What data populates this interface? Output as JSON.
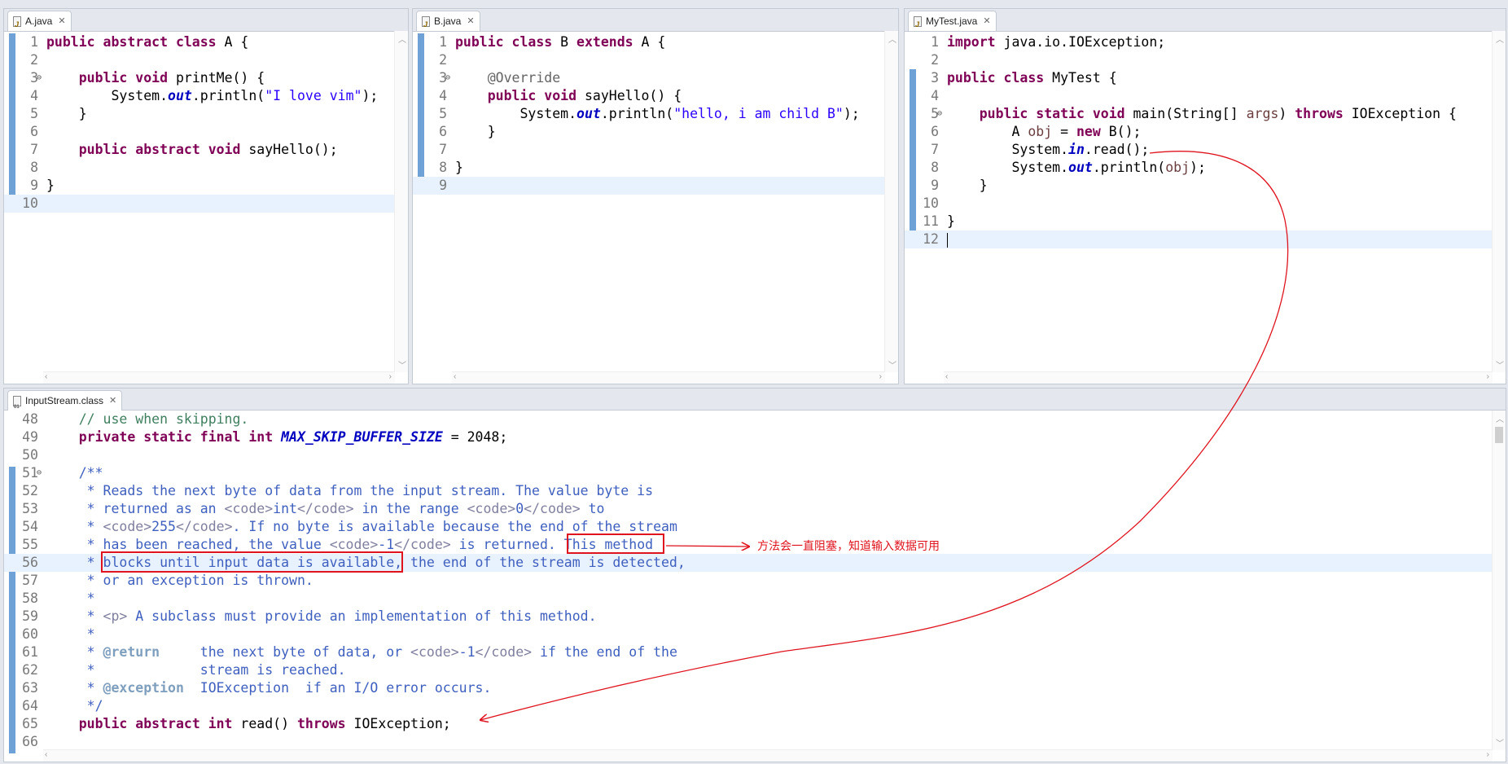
{
  "editors": {
    "a": {
      "tab_label": "A.java",
      "lines": [
        {
          "n": "1",
          "segs": [
            [
              "kw",
              "public abstract class"
            ],
            [
              "",
              " A {"
            ]
          ]
        },
        {
          "n": "2",
          "segs": [
            [
              "",
              ""
            ]
          ]
        },
        {
          "n": "3",
          "mark": "⊖",
          "segs": [
            [
              "",
              "    "
            ],
            [
              "kw",
              "public void"
            ],
            [
              "",
              " printMe() {"
            ]
          ]
        },
        {
          "n": "4",
          "segs": [
            [
              "",
              "        System."
            ],
            [
              "fld",
              "out"
            ],
            [
              "",
              ".println("
            ],
            [
              "st",
              "\"I love vim\""
            ],
            [
              "",
              ");"
            ]
          ]
        },
        {
          "n": "5",
          "segs": [
            [
              "",
              "    }"
            ]
          ]
        },
        {
          "n": "6",
          "segs": [
            [
              "",
              ""
            ]
          ]
        },
        {
          "n": "7",
          "segs": [
            [
              "",
              "    "
            ],
            [
              "kw",
              "public abstract void"
            ],
            [
              "",
              " sayHello();"
            ]
          ]
        },
        {
          "n": "8",
          "segs": [
            [
              "",
              ""
            ]
          ]
        },
        {
          "n": "9",
          "segs": [
            [
              "",
              "}"
            ]
          ]
        },
        {
          "n": "10",
          "cur": true,
          "segs": [
            [
              "",
              ""
            ]
          ]
        }
      ]
    },
    "b": {
      "tab_label": "B.java",
      "lines": [
        {
          "n": "1",
          "segs": [
            [
              "kw",
              "public class"
            ],
            [
              "",
              " B "
            ],
            [
              "kw",
              "extends"
            ],
            [
              "",
              " A {"
            ]
          ]
        },
        {
          "n": "2",
          "segs": [
            [
              "",
              ""
            ]
          ]
        },
        {
          "n": "3",
          "mark": "⊖",
          "segs": [
            [
              "",
              "    "
            ],
            [
              "an",
              "@Override"
            ]
          ]
        },
        {
          "n": "4",
          "segs": [
            [
              "",
              "    "
            ],
            [
              "kw",
              "public void"
            ],
            [
              "",
              " sayHello() {"
            ]
          ]
        },
        {
          "n": "5",
          "segs": [
            [
              "",
              "        System."
            ],
            [
              "fld",
              "out"
            ],
            [
              "",
              ".println("
            ],
            [
              "st",
              "\"hello, i am child B\""
            ],
            [
              "",
              ");"
            ]
          ]
        },
        {
          "n": "6",
          "segs": [
            [
              "",
              "    }"
            ]
          ]
        },
        {
          "n": "7",
          "segs": [
            [
              "",
              ""
            ]
          ]
        },
        {
          "n": "8",
          "segs": [
            [
              "",
              "}"
            ]
          ]
        },
        {
          "n": "9",
          "cur": true,
          "segs": [
            [
              "",
              ""
            ]
          ]
        }
      ]
    },
    "mytest": {
      "tab_label": "MyTest.java",
      "lines": [
        {
          "n": "1",
          "segs": [
            [
              "kw",
              "import"
            ],
            [
              "",
              " java.io.IOException;"
            ]
          ]
        },
        {
          "n": "2",
          "segs": [
            [
              "",
              ""
            ]
          ]
        },
        {
          "n": "3",
          "segs": [
            [
              "kw",
              "public class"
            ],
            [
              "",
              " MyTest {"
            ]
          ]
        },
        {
          "n": "4",
          "segs": [
            [
              "",
              ""
            ]
          ]
        },
        {
          "n": "5",
          "mark": "⊖",
          "segs": [
            [
              "",
              "    "
            ],
            [
              "kw",
              "public static void"
            ],
            [
              "",
              " main(String[] "
            ],
            [
              "lv",
              "args"
            ],
            [
              "",
              ") "
            ],
            [
              "kw",
              "throws"
            ],
            [
              "",
              " IOException {"
            ]
          ]
        },
        {
          "n": "6",
          "segs": [
            [
              "",
              "        A "
            ],
            [
              "lv",
              "obj"
            ],
            [
              "",
              " = "
            ],
            [
              "kw",
              "new"
            ],
            [
              "",
              " B();"
            ]
          ]
        },
        {
          "n": "7",
          "segs": [
            [
              "",
              "        System."
            ],
            [
              "fld",
              "in"
            ],
            [
              "",
              ".read();"
            ]
          ]
        },
        {
          "n": "8",
          "segs": [
            [
              "",
              "        System."
            ],
            [
              "fld",
              "out"
            ],
            [
              "",
              ".println("
            ],
            [
              "lv",
              "obj"
            ],
            [
              "",
              ");"
            ]
          ]
        },
        {
          "n": "9",
          "segs": [
            [
              "",
              "    }"
            ]
          ]
        },
        {
          "n": "10",
          "segs": [
            [
              "",
              ""
            ]
          ]
        },
        {
          "n": "11",
          "segs": [
            [
              "",
              "}"
            ]
          ]
        },
        {
          "n": "12",
          "cur": true,
          "caret": true,
          "segs": [
            [
              "",
              ""
            ]
          ]
        }
      ]
    },
    "inputstream": {
      "tab_label": "InputStream.class",
      "lines": [
        {
          "n": "48",
          "segs": [
            [
              "",
              "    "
            ],
            [
              "cm",
              "// use when skipping."
            ]
          ]
        },
        {
          "n": "49",
          "segs": [
            [
              "",
              "    "
            ],
            [
              "kw",
              "private static final int"
            ],
            [
              "",
              " "
            ],
            [
              "cst",
              "MAX_SKIP_BUFFER_SIZE"
            ],
            [
              "",
              " = 2048;"
            ]
          ]
        },
        {
          "n": "50",
          "segs": [
            [
              "",
              ""
            ]
          ]
        },
        {
          "n": "51",
          "mark": "⊖",
          "segs": [
            [
              "",
              "    "
            ],
            [
              "jd",
              "/**"
            ]
          ]
        },
        {
          "n": "52",
          "segs": [
            [
              "jd",
              "     * Reads the next byte of data from the input stream. The value byte is"
            ]
          ]
        },
        {
          "n": "53",
          "segs": [
            [
              "jd",
              "     * returned as an "
            ],
            [
              "jt",
              "<code>"
            ],
            [
              "jd",
              "int"
            ],
            [
              "jt",
              "</code>"
            ],
            [
              "jd",
              " in the range "
            ],
            [
              "jt",
              "<code>"
            ],
            [
              "jd",
              "0"
            ],
            [
              "jt",
              "</code>"
            ],
            [
              "jd",
              " to"
            ]
          ]
        },
        {
          "n": "54",
          "segs": [
            [
              "jd",
              "     * "
            ],
            [
              "jt",
              "<code>"
            ],
            [
              "jd",
              "255"
            ],
            [
              "jt",
              "</code>"
            ],
            [
              "jd",
              ". If no byte is available because the end of the stream"
            ]
          ]
        },
        {
          "n": "55",
          "segs": [
            [
              "jd",
              "     * has been reached, the value "
            ],
            [
              "jt",
              "<code>"
            ],
            [
              "jd",
              "-1"
            ],
            [
              "jt",
              "</code>"
            ],
            [
              "jd",
              " is returned. This method"
            ]
          ]
        },
        {
          "n": "56",
          "cur": true,
          "segs": [
            [
              "jd",
              "     * blocks until input data is available, the end of the stream is detected,"
            ]
          ]
        },
        {
          "n": "57",
          "segs": [
            [
              "jd",
              "     * or an exception is thrown."
            ]
          ]
        },
        {
          "n": "58",
          "segs": [
            [
              "jd",
              "     *"
            ]
          ]
        },
        {
          "n": "59",
          "segs": [
            [
              "jd",
              "     * "
            ],
            [
              "jt",
              "<p>"
            ],
            [
              "jd",
              " A subclass must provide an implementation of this method."
            ]
          ]
        },
        {
          "n": "60",
          "segs": [
            [
              "jd",
              "     *"
            ]
          ]
        },
        {
          "n": "61",
          "segs": [
            [
              "jd",
              "     * "
            ],
            [
              "jk",
              "@return"
            ],
            [
              "jd",
              "     the next byte of data, or "
            ],
            [
              "jt",
              "<code>"
            ],
            [
              "jd",
              "-1"
            ],
            [
              "jt",
              "</code>"
            ],
            [
              "jd",
              " if the end of the"
            ]
          ]
        },
        {
          "n": "62",
          "segs": [
            [
              "jd",
              "     *             stream is reached."
            ]
          ]
        },
        {
          "n": "63",
          "segs": [
            [
              "jd",
              "     * "
            ],
            [
              "jk",
              "@exception"
            ],
            [
              "jd",
              "  IOException  if an I/O error occurs."
            ]
          ]
        },
        {
          "n": "64",
          "segs": [
            [
              "jd",
              "     */"
            ]
          ]
        },
        {
          "n": "65",
          "segs": [
            [
              "",
              "    "
            ],
            [
              "kw",
              "public abstract int"
            ],
            [
              "",
              " read() "
            ],
            [
              "kw",
              "throws"
            ],
            [
              "",
              " IOException;"
            ]
          ]
        },
        {
          "n": "66",
          "segs": [
            [
              "",
              ""
            ]
          ]
        }
      ]
    }
  },
  "annotation": {
    "note": "方法会一直阻塞，知道输入数据可用",
    "color": "#e0141e"
  }
}
